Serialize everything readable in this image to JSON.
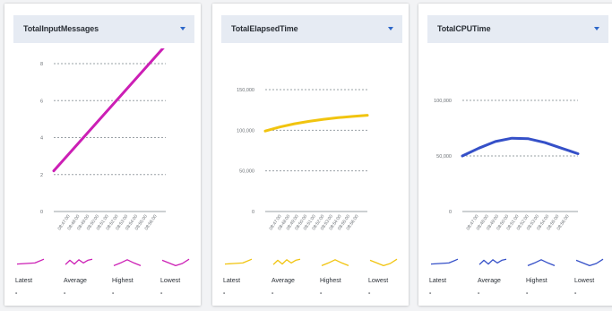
{
  "stat_labels": [
    "Latest",
    "Average",
    "Highest",
    "Lowest"
  ],
  "cards": [
    {
      "title": "TotalInputMessages",
      "color": "#cc1fb5",
      "stat_values": [
        "-",
        "-",
        "-",
        "-"
      ],
      "chart_data": {
        "type": "line",
        "y_ticks": [
          "0",
          "2",
          "4",
          "6",
          "8"
        ],
        "ylim": [
          0,
          8
        ],
        "x_labels": [
          "08:47:00",
          "08:48:00",
          "08:49:00",
          "08:50:00",
          "08:51:00",
          "08:52:00",
          "08:53:00",
          "08:54:00",
          "08:55:00",
          "08:56:00"
        ],
        "series": [
          {
            "values": [
              2.2,
              9.0
            ]
          }
        ]
      }
    },
    {
      "title": "TotalElapsedTime",
      "color": "#f1c40f",
      "stat_values": [
        "-",
        "-",
        "-",
        "-"
      ],
      "chart_data": {
        "type": "line",
        "y_ticks": [
          "0",
          "50,000",
          "100,000",
          "150,000"
        ],
        "ylim": [
          0,
          150000
        ],
        "x_labels": [
          "08:47:00",
          "08:48:00",
          "08:49:00",
          "08:50:00",
          "08:51:00",
          "08:52:00",
          "08:53:00",
          "08:54:00",
          "08:55:00",
          "08:56:00"
        ],
        "series": [
          {
            "values": [
              99000,
              104000,
              108000,
              111000,
              113500,
              115500,
              117000,
              118500
            ]
          }
        ]
      }
    },
    {
      "title": "TotalCPUTime",
      "color": "#3550c8",
      "stat_values": [
        "-",
        "-",
        "-",
        "-"
      ],
      "chart_data": {
        "type": "line",
        "y_ticks": [
          "0",
          "50,000",
          "100,000"
        ],
        "ylim": [
          0,
          100000
        ],
        "x_labels": [
          "08:47:00",
          "08:48:00",
          "08:49:00",
          "08:50:00",
          "08:51:00",
          "08:52:00",
          "08:53:00",
          "08:54:00",
          "08:55:00",
          "08:56:00"
        ],
        "series": [
          {
            "values": [
              50000,
              57000,
              63000,
              66000,
              65500,
              62000,
              57000,
              52000
            ]
          }
        ]
      }
    }
  ]
}
